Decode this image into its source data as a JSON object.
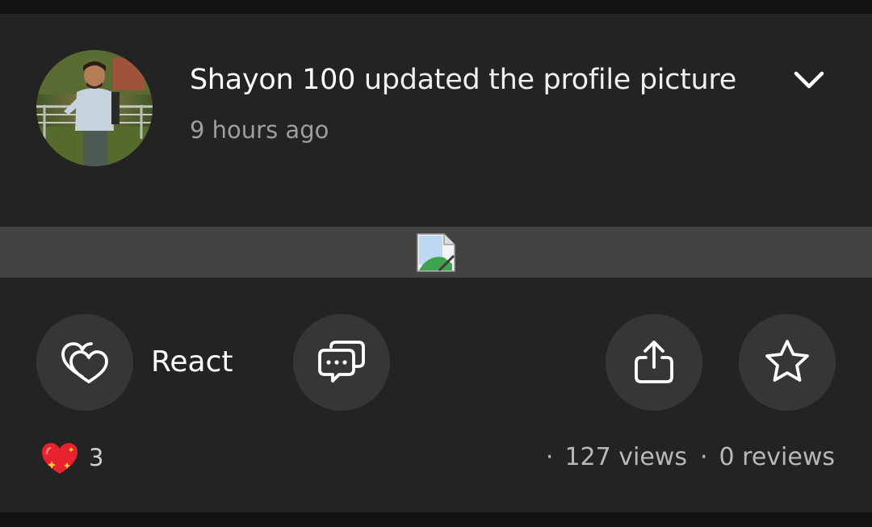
{
  "post": {
    "author": "Shayon 100",
    "action": "updated the profile picture",
    "timestamp": "9 hours ago"
  },
  "icons": {
    "menu": "chevron-down-icon",
    "image": "broken-image-icon",
    "react": "double-heart-icon",
    "comment": "comment-bubbles-icon",
    "share": "share-icon",
    "save": "star-icon",
    "reaction_emoji": "sparkling-heart-icon"
  },
  "actions": {
    "react_label": "React"
  },
  "stats": {
    "reaction_count": "3",
    "views": "127 views",
    "reviews": "0 reviews",
    "separator": "·"
  },
  "colors": {
    "background": "#121212",
    "card": "#232323",
    "button": "#363636",
    "image_strip": "#434343",
    "secondary_text": "#9e9e9e",
    "reaction_red": "#e8232f"
  }
}
